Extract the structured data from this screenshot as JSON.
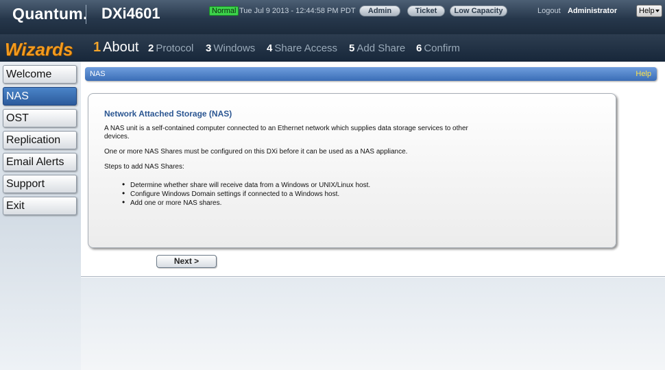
{
  "header": {
    "logo": "Quantum.",
    "model": "DXi4601",
    "status": "Normal",
    "datetime": "Tue Jul 9 2013 - 12:44:58 PM PDT",
    "admin_label": "Admin",
    "ticket_label": "Ticket",
    "low_capacity_label": "Low Capacity",
    "logout_label": "Logout",
    "user": "Administrator",
    "help_label": "Help"
  },
  "wizard": {
    "title": "Wizards",
    "steps": [
      {
        "num": "1",
        "label": "About"
      },
      {
        "num": "2",
        "label": "Protocol"
      },
      {
        "num": "3",
        "label": "Windows"
      },
      {
        "num": "4",
        "label": "Share Access"
      },
      {
        "num": "5",
        "label": "Add Share"
      },
      {
        "num": "6",
        "label": "Confirm"
      }
    ]
  },
  "sidebar": {
    "items": [
      {
        "label": "Welcome"
      },
      {
        "label": "NAS"
      },
      {
        "label": "OST"
      },
      {
        "label": "Replication"
      },
      {
        "label": "Email Alerts"
      },
      {
        "label": "Support"
      },
      {
        "label": "Exit"
      }
    ]
  },
  "panel": {
    "title": "NAS",
    "help": "Help",
    "heading": "Network Attached Storage (NAS)",
    "para1": "A NAS unit is a self-contained computer connected to an Ethernet network which supplies data storage services to other devices.",
    "para2": "One or more NAS Shares must be configured on this DXi before it can be used as a NAS appliance.",
    "para3": "Steps to add NAS Shares:",
    "bullets": [
      "Determine whether share will receive data from a Windows or UNIX/Linux host.",
      "Configure Windows Domain settings if connected to a Windows host.",
      "Add one or more NAS shares."
    ],
    "next_label": "Next >"
  },
  "colors": {
    "header_bg": "#26374b",
    "wizard_title": "#f39a1e",
    "panel_header": "#3a6db6",
    "status_normal": "#3cd24b",
    "active_item": "#2c5b9c"
  }
}
